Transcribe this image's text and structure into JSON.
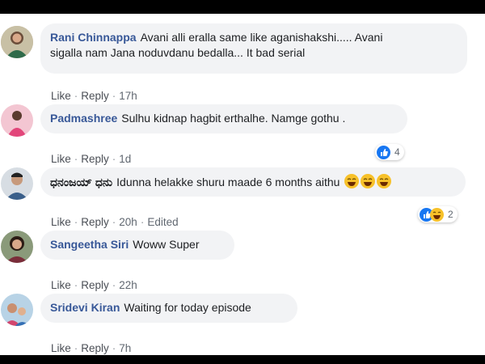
{
  "comments": [
    {
      "name": "Rani Chinnappa",
      "text_line1": "Avani alli eralla same like aganishakshi..... Avani",
      "text_line2": "sigalla nam Jana noduvdanu bedalla... It bad serial",
      "like": "Like",
      "reply": "Reply",
      "time": "17h"
    },
    {
      "name": "Padmashree",
      "text": "Sulhu kidnap hagbit erthalhe. Namge gothu .",
      "like": "Like",
      "reply": "Reply",
      "time": "1d",
      "reaction_count": "4",
      "reactions": [
        "like-icon"
      ]
    },
    {
      "name": "ಧನಂಜಯ್ ಧನು",
      "text": "Idunna helakke shuru maade 6 months aithu",
      "inline_emoji": [
        "laughing-emoji",
        "laughing-emoji",
        "laughing-emoji"
      ],
      "like": "Like",
      "reply": "Reply",
      "time": "20h",
      "edited": "Edited",
      "reaction_count": "2",
      "reactions": [
        "like-icon",
        "haha-icon"
      ]
    },
    {
      "name": "Sangeetha Siri",
      "text": "Woww Super",
      "like": "Like",
      "reply": "Reply",
      "time": "22h"
    },
    {
      "name": "Sridevi Kiran",
      "text": "Waiting for today episode",
      "like": "Like",
      "reply": "Reply",
      "time": "7h"
    }
  ],
  "colors": {
    "name_link": "#385898",
    "bubble_bg": "#f2f3f5",
    "like_blue": "#1877f2",
    "haha_yellow": "#f7c12a",
    "meta_gray": "#606770"
  }
}
